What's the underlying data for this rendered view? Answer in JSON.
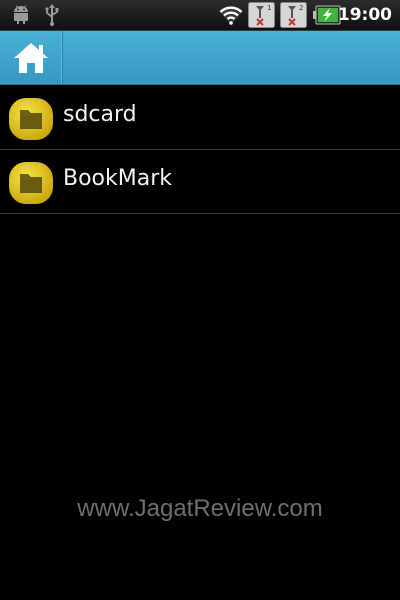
{
  "status_bar": {
    "time": "19:00",
    "left_icons": [
      "android-debug-icon",
      "usb-icon"
    ],
    "right_icons": [
      "wifi-icon",
      "sim-1-no-signal-icon",
      "sim-2-no-signal-icon",
      "battery-charging-icon"
    ]
  },
  "title_bar": {
    "home_icon": "home-icon",
    "background": "#3ea3cc"
  },
  "files": [
    {
      "label": "sdcard",
      "icon": "folder-icon"
    },
    {
      "label": "BookMark",
      "icon": "folder-icon"
    }
  ],
  "watermark": "www.JagatReview.com",
  "colors": {
    "folder": "#e8c614",
    "background": "#000000",
    "accent": "#3ea3cc"
  }
}
